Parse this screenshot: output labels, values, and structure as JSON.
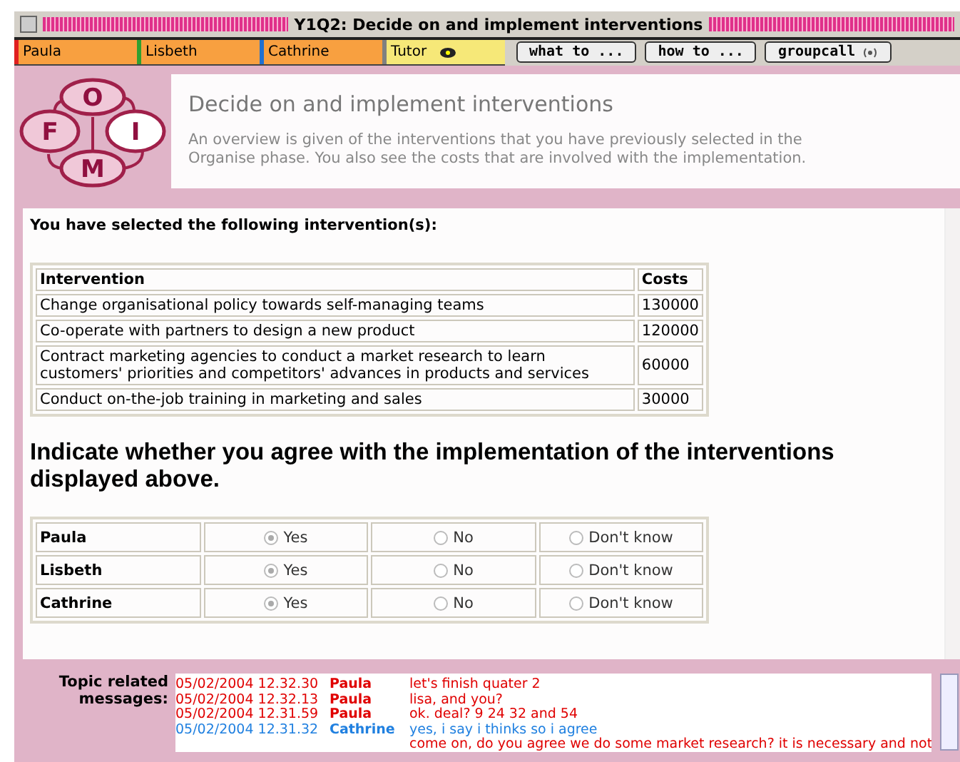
{
  "window": {
    "title": "Y1Q2: Decide on and implement interventions"
  },
  "participants": [
    {
      "name": "Paula",
      "color": "#e02020",
      "kind": "student"
    },
    {
      "name": "Lisbeth",
      "color": "#30a030",
      "kind": "student"
    },
    {
      "name": "Cathrine",
      "color": "#2070d0",
      "kind": "student"
    },
    {
      "name": "Tutor",
      "color": "#808080",
      "kind": "tutor"
    }
  ],
  "toolbar_buttons": [
    {
      "label": "what to ...",
      "kind": "text"
    },
    {
      "label": "how to ...",
      "kind": "text"
    },
    {
      "label": "groupcall",
      "kind": "call"
    }
  ],
  "header": {
    "title": "Decide on and implement interventions",
    "description": "An overview is given of the interventions that you have previously selected in the Organise phase. You also see the costs that are involved with the implementation.",
    "logo_letters": [
      "O",
      "F",
      "I",
      "M"
    ]
  },
  "content": {
    "intro": "You have selected the following intervention(s):",
    "table": {
      "columns": [
        "Intervention",
        "Costs"
      ],
      "rows": [
        [
          "Change organisational policy towards self-managing teams",
          "130000"
        ],
        [
          "Co-operate with partners to design a new product",
          "120000"
        ],
        [
          "Contract marketing agencies to conduct a market research to learn customers' priorities and competitors' advances in products and services",
          "60000"
        ],
        [
          "Conduct on-the-job training in marketing and sales",
          "30000"
        ]
      ]
    },
    "question": "Indicate whether you agree with the implementation of the interventions displayed above.",
    "votes": [
      {
        "name": "Paula",
        "options": [
          {
            "label": "Yes",
            "selected": true
          },
          {
            "label": "No",
            "selected": false
          },
          {
            "label": "Don't know",
            "selected": false
          }
        ]
      },
      {
        "name": "Lisbeth",
        "options": [
          {
            "label": "Yes",
            "selected": true
          },
          {
            "label": "No",
            "selected": false
          },
          {
            "label": "Don't know",
            "selected": false
          }
        ]
      },
      {
        "name": "Cathrine",
        "options": [
          {
            "label": "Yes",
            "selected": true
          },
          {
            "label": "No",
            "selected": false
          },
          {
            "label": "Don't know",
            "selected": false
          }
        ]
      }
    ]
  },
  "messages": {
    "label": "Topic related messages:",
    "items": [
      {
        "time": "05/02/2004 12.32.30",
        "author": "Paula",
        "text": "let's finish quater 2",
        "color": "#e00000"
      },
      {
        "time": "05/02/2004 12.32.13",
        "author": "Paula",
        "text": "lisa, and you?",
        "color": "#e00000"
      },
      {
        "time": "05/02/2004 12.31.59",
        "author": "Paula",
        "text": "ok. deal? 9 24 32 and 54",
        "color": "#e00000"
      },
      {
        "time": "05/02/2004 12.31.32",
        "author": "Cathrine",
        "text": "yes, i say i thinks so i agree",
        "color": "#2080e0"
      },
      {
        "text": "come on, do you agree we do some market research? it is necessary and not",
        "color": "#e00000"
      }
    ]
  }
}
